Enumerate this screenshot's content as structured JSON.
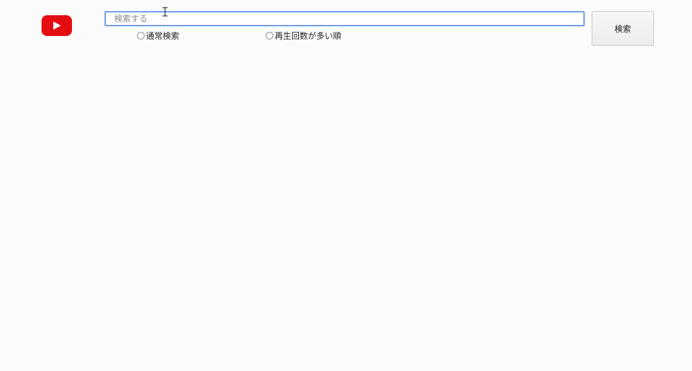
{
  "logo": {
    "name": "youtube-logo",
    "color": "#e30d12"
  },
  "search": {
    "placeholder": "検索する",
    "value": "",
    "button_label": "検索",
    "focus_border_color": "#6d9ee9"
  },
  "sort_options": [
    {
      "label": "通常検索",
      "selected": false
    },
    {
      "label": "再生回数が多い順",
      "selected": false
    }
  ],
  "cursor": {
    "icon": "text-cursor-icon"
  }
}
